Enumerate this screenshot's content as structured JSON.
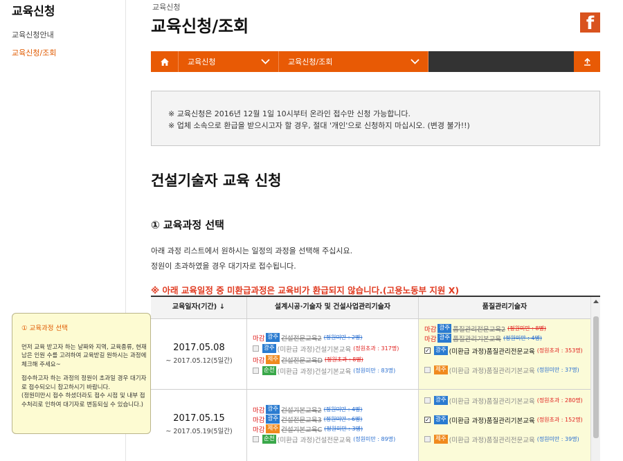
{
  "sidebar": {
    "title": "교육신청",
    "items": [
      {
        "label": "교육신청안내",
        "active": false
      },
      {
        "label": "교육신청/조회",
        "active": true
      }
    ]
  },
  "header": {
    "breadcrumb": "교육신청",
    "title": "교육신청/조회"
  },
  "navbar": {
    "select1": "교육신청",
    "select2": "교육신청/조회"
  },
  "notice": {
    "line1": "※ 교육신청은 2016년 12월 1일 10시부터 온라인 접수만 신청 가능합니다.",
    "line2": "※ 업체 소속으로 환급을 받으시고자 할 경우, 절대 '개인'으로 신청하지 마십시오. (변경 불가!!)"
  },
  "main": {
    "heading": "건설기술자 교육 신청",
    "section": "① 교육과정 선택",
    "desc1": "아래 과정 리스트에서 원하시는 일정의 과정을 선택해 주십시요.",
    "desc2": "정원이 초과하였을 경우 대기자로 접수됩니다.",
    "warning": "※ 아래 교육일정 중 미환급과정은 교육비가 환급되지 않습니다.(고용노동부 지원 X)"
  },
  "table": {
    "headers": [
      "교육일자(기간) ↓",
      "설계시공·기술자 및 건설사업관리기술자",
      "품질관리기술자"
    ],
    "rows": [
      {
        "date": "2017.05.08",
        "period": "~ 2017.05.12(5일간)",
        "col2": [
          {
            "closed": "마감",
            "region": "광주",
            "regionColor": "blue",
            "name": "건설전문교육2",
            "cap": "(정원미만 : 2명)",
            "struck": true
          },
          {
            "checkbox": "off",
            "region": "광주",
            "regionColor": "blue",
            "name": "(미환급 과정)건설기본교육",
            "cap": "(정원초과 : 317명)",
            "capColor": "red"
          },
          {
            "closed": "마감",
            "region": "제주",
            "regionColor": "orange",
            "name": "건설전문교육D",
            "cap": "(정원초과 : 8명)",
            "struck": true
          },
          {
            "checkbox": "off",
            "region": "순천",
            "regionColor": "green",
            "name": "(미환급 과정)건설기본교육",
            "cap": "(정원미만 : 83명)",
            "capColor": "blue"
          }
        ],
        "col3": [
          {
            "closed": "마감",
            "region": "광주",
            "regionColor": "blue",
            "name": "품질관리전문교육2",
            "cap": "(정원미만 : 8명)",
            "struck": true
          },
          {
            "closed": "마감",
            "region": "광주",
            "regionColor": "blue",
            "name": "품질관리기본교육",
            "cap": "(정원미만 : 4명)",
            "struck": true
          },
          {
            "checkbox": "on",
            "region": "광주",
            "regionColor": "blue",
            "name": "(미환급 과정)품질관리전문교육",
            "cap": "(정원초과 : 353명)",
            "capColor": "red",
            "dark": true
          },
          {
            "checkbox": "off",
            "region": "제주",
            "regionColor": "orange",
            "name": "(미환급 과정)품질관리기본교육",
            "cap": "(정원미만 : 37명)",
            "capColor": "blue"
          }
        ]
      },
      {
        "date": "2017.05.15",
        "period": "~ 2017.05.19(5일간)",
        "col2": [
          {
            "closed": "마감",
            "region": "광주",
            "regionColor": "blue",
            "name": "건설기본교육2",
            "cap": "(정원미만 : 4명)",
            "struck": true
          },
          {
            "closed": "마감",
            "region": "광주",
            "regionColor": "blue",
            "name": "건설전문교육3",
            "cap": "(정원미만 : 6명)",
            "struck": true
          },
          {
            "closed": "마감",
            "region": "제주",
            "regionColor": "orange",
            "name": "건설기본교육C",
            "cap": "(정원미만 : 3명)",
            "struck": true
          },
          {
            "checkbox": "off",
            "region": "순천",
            "regionColor": "green",
            "name": "(미환급 과정)건설전문교육",
            "cap": "(정원미만 : 89명)",
            "capColor": "blue"
          }
        ],
        "col3": [
          {
            "checkbox": "off",
            "region": "광주",
            "regionColor": "blue",
            "name": "(미환급 과정)품질관리기본교육",
            "cap": "(정원초과 : 280명)",
            "capColor": "red"
          },
          {
            "checkbox": "on",
            "region": "광주",
            "regionColor": "blue",
            "name": "(미환급 과정)품질관리기본교육",
            "cap": "(정원초과 : 152명)",
            "capColor": "red",
            "dark": true
          },
          {
            "checkbox": "off",
            "region": "제주",
            "regionColor": "orange",
            "name": "(미환급 과정)품질관리전문교육",
            "cap": "(정원미만 : 39명)",
            "capColor": "blue"
          }
        ]
      }
    ]
  },
  "tooltip": {
    "title": "① 교육과정 선택",
    "p1": "먼저 교육 받고자 하는 날짜와 지역, 교육종류, 현재 남은 인원 수를 고려하여 교육받길 원하시는 과정에 체크해 주세요~",
    "p2": "접수하고자 하는 과정의 정원이 초과일 경우 대기자로 접수되오니 참고하시기 바랍니다.",
    "p3": "(정원미만시 접수 하셨더라도 접수 시점 및 내부 접수처리로 인하여 대기자로 변동되실 수 있습니다.)"
  },
  "icons": {
    "home": "home-icon",
    "chevron": "chevron-down-icon",
    "up": "scroll-top-icon",
    "facebook": "facebook-icon"
  },
  "colors": {
    "accent": "#e85a05",
    "closed": "#e0201e",
    "regionBlue": "#2a7bd0",
    "regionOrange": "#f08a1e",
    "regionGreen": "#3aa84a"
  }
}
